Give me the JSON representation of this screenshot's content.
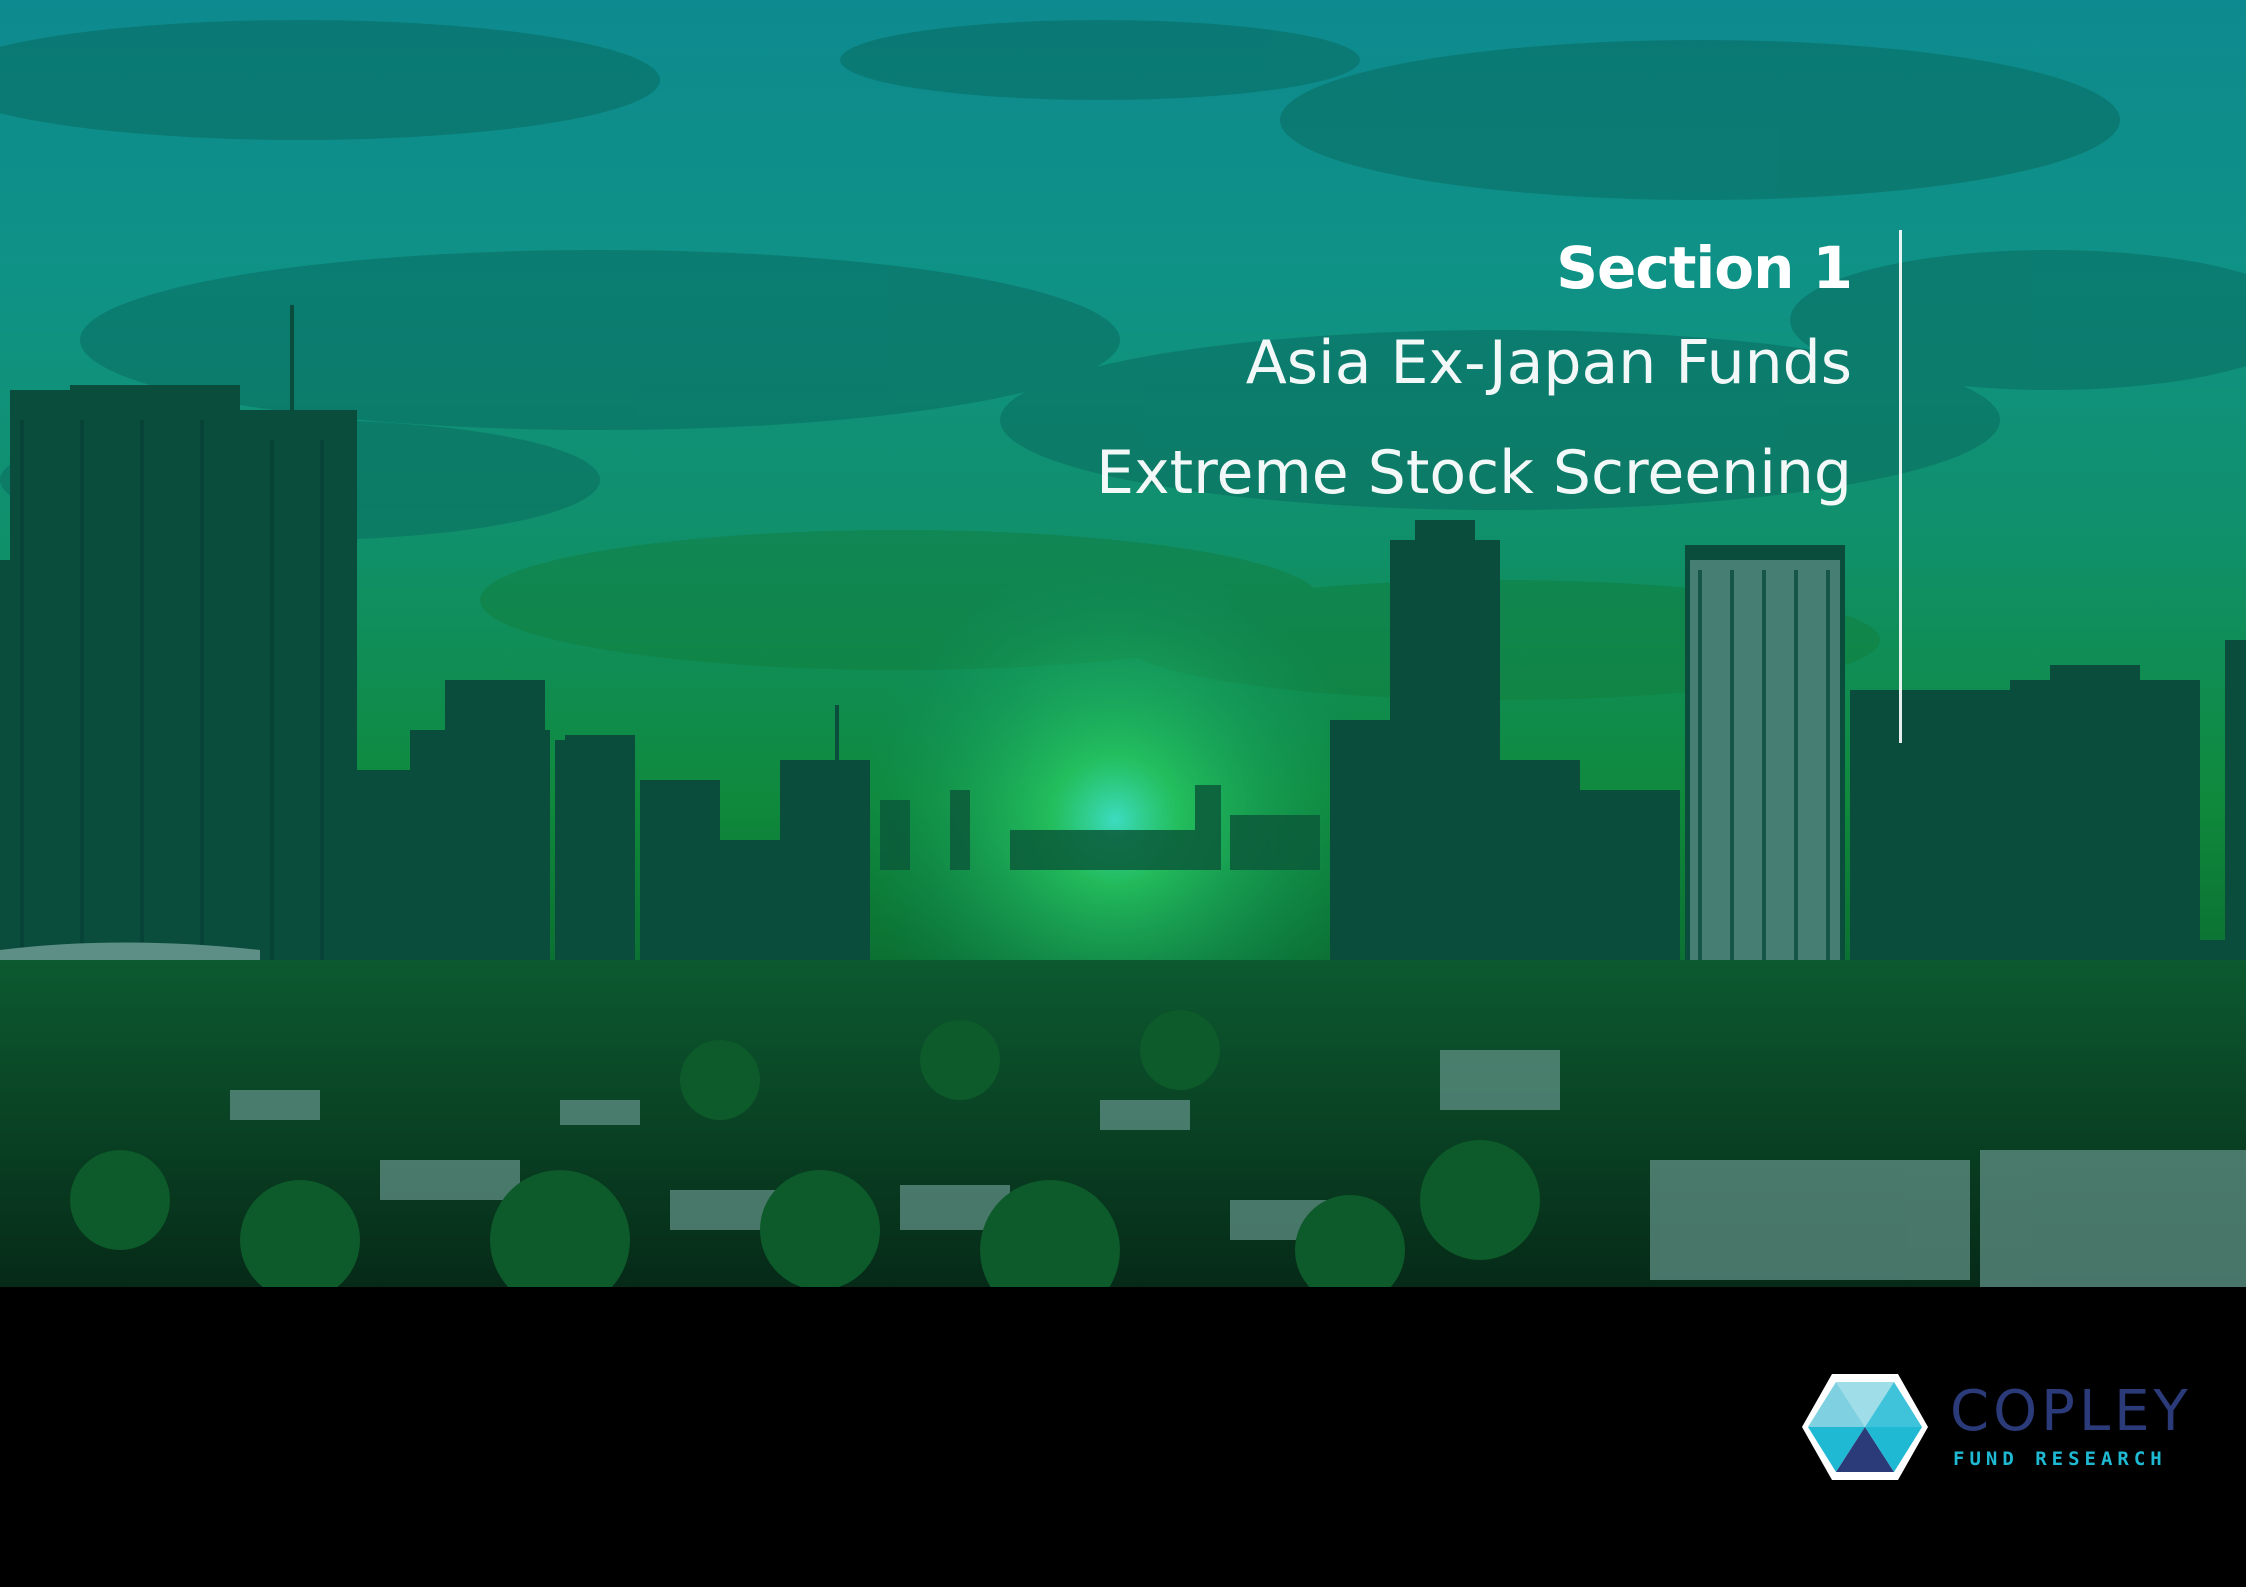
{
  "page": {
    "section_label": "Section 1",
    "subtitle_line1": "Asia Ex-Japan Funds",
    "subtitle_line2": "Extreme Stock Screening"
  },
  "brand": {
    "name": "COPLEY",
    "tagline": "FUND RESEARCH",
    "logo_icon": "hexagon-logo-icon",
    "colors": {
      "name": "#2b3a78",
      "tagline": "#1fb9d3",
      "hex_light": "#9fdde8",
      "hex_mid": "#1fb9d3",
      "hex_dark": "#2b3a78"
    }
  },
  "background": {
    "description_icon": "city-skyline-image",
    "overlay_color": "#0f9a4a"
  }
}
